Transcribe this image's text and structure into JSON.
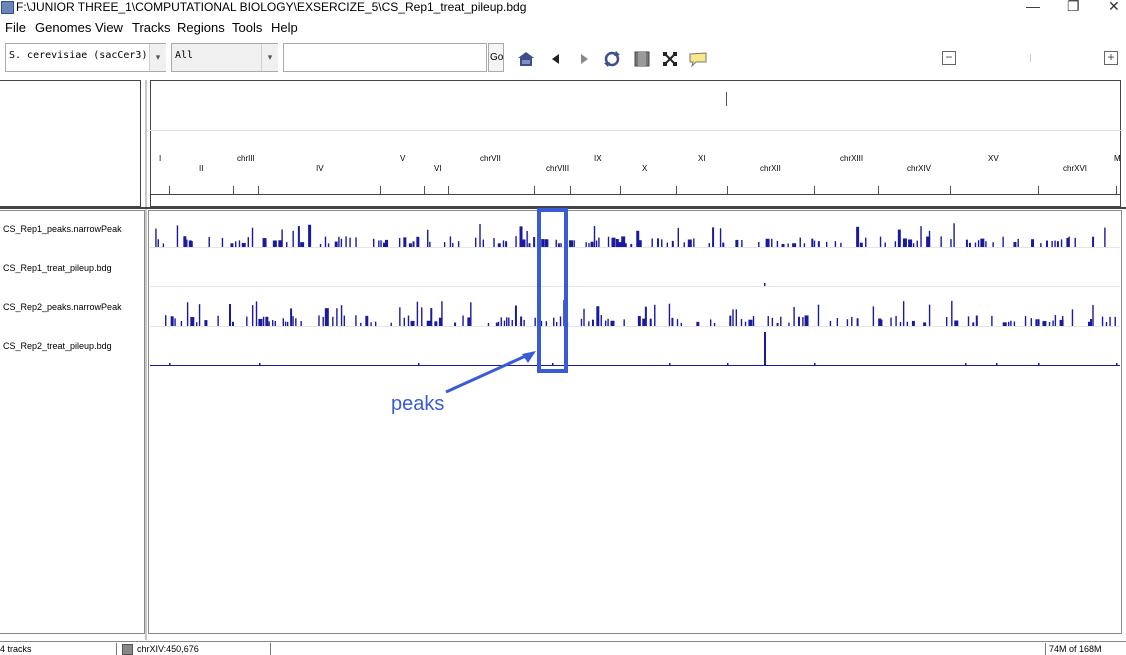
{
  "window": {
    "title": "F:\\JUNIOR THREE_1\\COMPUTATIONAL BIOLOGY\\EXSERCIZE_5\\CS_Rep1_treat_pileup.bdg",
    "minimize_glyph": "—",
    "restore_glyph": "❐",
    "close_glyph": "✕"
  },
  "menu": [
    "File",
    "Genomes",
    "View",
    "Tracks",
    "Regions",
    "Tools",
    "Help"
  ],
  "toolbar": {
    "genome": "S. cerevisiae (sacCer3)",
    "chromosome": "All",
    "locus": "",
    "go_label": "Go",
    "dropdown_glyph": "▾",
    "zoom_out_glyph": "−",
    "zoom_in_glyph": "+",
    "icons": [
      "home-icon",
      "back-icon",
      "forward-icon",
      "refresh-icon",
      "region-of-interest-icon",
      "resize-icon",
      "popup-text-icon"
    ]
  },
  "chromosomes": [
    {
      "name": "I",
      "row": "upper"
    },
    {
      "name": "II",
      "row": "lower"
    },
    {
      "name": "chrIII",
      "row": "upper"
    },
    {
      "name": "IV",
      "row": "lower"
    },
    {
      "name": "V",
      "row": "upper"
    },
    {
      "name": "VI",
      "row": "lower"
    },
    {
      "name": "chrVII",
      "row": "upper"
    },
    {
      "name": "chrVIII",
      "row": "lower"
    },
    {
      "name": "IX",
      "row": "upper"
    },
    {
      "name": "X",
      "row": "lower"
    },
    {
      "name": "XI",
      "row": "upper"
    },
    {
      "name": "chrXII",
      "row": "lower"
    },
    {
      "name": "chrXIII",
      "row": "upper"
    },
    {
      "name": "chrXIV",
      "row": "lower"
    },
    {
      "name": "XV",
      "row": "upper"
    },
    {
      "name": "chrXVI",
      "row": "lower"
    },
    {
      "name": "M",
      "row": "upper"
    }
  ],
  "tracks": [
    {
      "name": "CS_Rep1_peaks.narrowPeak",
      "type": "peaks"
    },
    {
      "name": "CS_Rep1_treat_pileup.bdg",
      "type": "pileup"
    },
    {
      "name": "CS_Rep2_peaks.narrowPeak",
      "type": "peaks"
    },
    {
      "name": "CS_Rep2_treat_pileup.bdg",
      "type": "pileup"
    }
  ],
  "annotation": {
    "label": "peaks",
    "color": "#3a5bd6"
  },
  "status": {
    "tracks": "4 tracks",
    "position": "chrXIV:450,676",
    "memory": "74M of 168M"
  },
  "colors": {
    "track": "#1a1a9e",
    "annotation": "#3a5bd6"
  }
}
